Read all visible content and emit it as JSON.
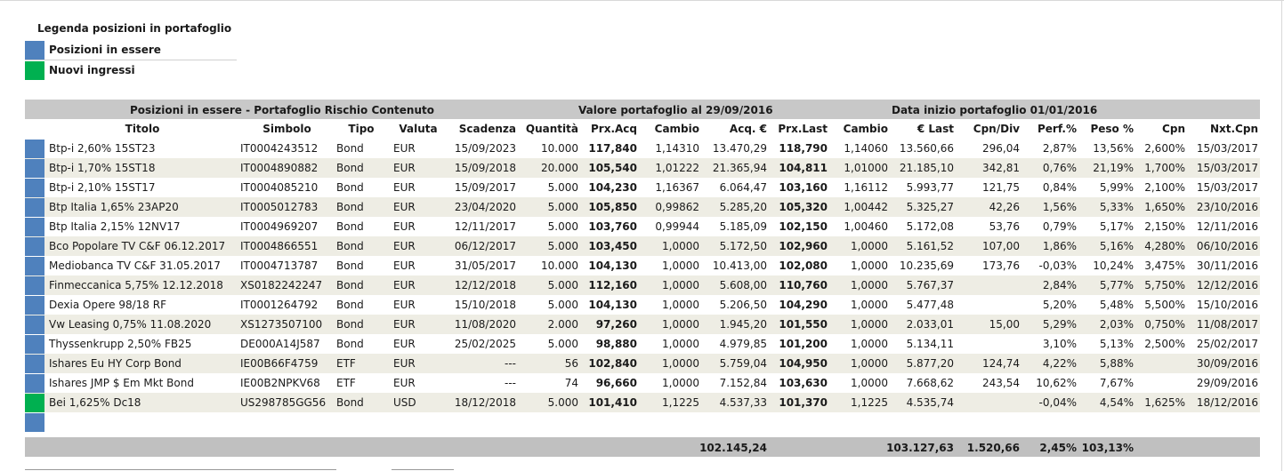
{
  "colors": {
    "existing": "#4f81bd",
    "new": "#00b050",
    "header_band": "#c8c8c8",
    "alt_row": "#eeede4",
    "total_band": "#c0c0c0"
  },
  "legend": {
    "title": "Legenda posizioni in portafoglio",
    "items": [
      {
        "label": "Posizioni in essere",
        "color": "#4f81bd"
      },
      {
        "label": "Nuovi ingressi",
        "color": "#00b050"
      }
    ]
  },
  "header": {
    "section": "Posizioni in essere - Portafoglio Rischio Contenuto",
    "value_date": "Valore portafoglio al 29/09/2016",
    "start_date": "Data inizio portafoglio 01/01/2016"
  },
  "columns": [
    "Titolo",
    "Simbolo",
    "Tipo",
    "Valuta",
    "Scadenza",
    "Quantità",
    "Prx.Acq",
    "Cambio",
    "Acq. €",
    "Prx.Last",
    "Cambio",
    "€ Last",
    "Cpn/Div",
    "Perf.%",
    "Peso %",
    "Cpn",
    "Nxt.Cpn"
  ],
  "rows": [
    {
      "status": "existing",
      "titolo": "Btp-i 2,60% 15ST23",
      "simbolo": "IT0004243512",
      "tipo": "Bond",
      "valuta": "EUR",
      "scadenza": "15/09/2023",
      "quantita": "10.000",
      "prx_acq": "117,840",
      "cambio_acq": "1,14310",
      "acq_eur": "13.470,29",
      "prx_last": "118,790",
      "cambio_last": "1,14060",
      "eur_last": "13.560,66",
      "cpn_div": "296,04",
      "perf": "2,87%",
      "peso": "13,56%",
      "cpn": "2,600%",
      "nxt_cpn": "15/03/2017"
    },
    {
      "status": "existing",
      "titolo": "Btp-i 1,70% 15ST18",
      "simbolo": "IT0004890882",
      "tipo": "Bond",
      "valuta": "EUR",
      "scadenza": "15/09/2018",
      "quantita": "20.000",
      "prx_acq": "105,540",
      "cambio_acq": "1,01222",
      "acq_eur": "21.365,94",
      "prx_last": "104,811",
      "cambio_last": "1,01000",
      "eur_last": "21.185,10",
      "cpn_div": "342,81",
      "perf": "0,76%",
      "peso": "21,19%",
      "cpn": "1,700%",
      "nxt_cpn": "15/03/2017"
    },
    {
      "status": "existing",
      "titolo": "Btp-i 2,10% 15ST17",
      "simbolo": "IT0004085210",
      "tipo": "Bond",
      "valuta": "EUR",
      "scadenza": "15/09/2017",
      "quantita": "5.000",
      "prx_acq": "104,230",
      "cambio_acq": "1,16367",
      "acq_eur": "6.064,47",
      "prx_last": "103,160",
      "cambio_last": "1,16112",
      "eur_last": "5.993,77",
      "cpn_div": "121,75",
      "perf": "0,84%",
      "peso": "5,99%",
      "cpn": "2,100%",
      "nxt_cpn": "15/03/2017"
    },
    {
      "status": "existing",
      "titolo": "Btp Italia 1,65% 23AP20",
      "simbolo": "IT0005012783",
      "tipo": "Bond",
      "valuta": "EUR",
      "scadenza": "23/04/2020",
      "quantita": "5.000",
      "prx_acq": "105,850",
      "cambio_acq": "0,99862",
      "acq_eur": "5.285,20",
      "prx_last": "105,320",
      "cambio_last": "1,00442",
      "eur_last": "5.325,27",
      "cpn_div": "42,26",
      "perf": "1,56%",
      "peso": "5,33%",
      "cpn": "1,650%",
      "nxt_cpn": "23/10/2016"
    },
    {
      "status": "existing",
      "titolo": "Btp Italia 2,15% 12NV17",
      "simbolo": "IT0004969207",
      "tipo": "Bond",
      "valuta": "EUR",
      "scadenza": "12/11/2017",
      "quantita": "5.000",
      "prx_acq": "103,760",
      "cambio_acq": "0,99944",
      "acq_eur": "5.185,09",
      "prx_last": "102,150",
      "cambio_last": "1,00460",
      "eur_last": "5.172,08",
      "cpn_div": "53,76",
      "perf": "0,79%",
      "peso": "5,17%",
      "cpn": "2,150%",
      "nxt_cpn": "12/11/2016"
    },
    {
      "status": "existing",
      "titolo": "Bco Popolare TV C&F 06.12.2017",
      "simbolo": "IT0004866551",
      "tipo": "Bond",
      "valuta": "EUR",
      "scadenza": "06/12/2017",
      "quantita": "5.000",
      "prx_acq": "103,450",
      "cambio_acq": "1,0000",
      "acq_eur": "5.172,50",
      "prx_last": "102,960",
      "cambio_last": "1,0000",
      "eur_last": "5.161,52",
      "cpn_div": "107,00",
      "perf": "1,86%",
      "peso": "5,16%",
      "cpn": "4,280%",
      "nxt_cpn": "06/10/2016"
    },
    {
      "status": "existing",
      "titolo": "Mediobanca TV C&F 31.05.2017",
      "simbolo": "IT0004713787",
      "tipo": "Bond",
      "valuta": "EUR",
      "scadenza": "31/05/2017",
      "quantita": "10.000",
      "prx_acq": "104,130",
      "cambio_acq": "1,0000",
      "acq_eur": "10.413,00",
      "prx_last": "102,080",
      "cambio_last": "1,0000",
      "eur_last": "10.235,69",
      "cpn_div": "173,76",
      "perf": "-0,03%",
      "peso": "10,24%",
      "cpn": "3,475%",
      "nxt_cpn": "30/11/2016"
    },
    {
      "status": "existing",
      "titolo": "Finmeccanica 5,75% 12.12.2018",
      "simbolo": "XS0182242247",
      "tipo": "Bond",
      "valuta": "EUR",
      "scadenza": "12/12/2018",
      "quantita": "5.000",
      "prx_acq": "112,160",
      "cambio_acq": "1,0000",
      "acq_eur": "5.608,00",
      "prx_last": "110,760",
      "cambio_last": "1,0000",
      "eur_last": "5.767,37",
      "cpn_div": "",
      "perf": "2,84%",
      "peso": "5,77%",
      "cpn": "5,750%",
      "nxt_cpn": "12/12/2016"
    },
    {
      "status": "existing",
      "titolo": "Dexia Opere 98/18 RF",
      "simbolo": "IT0001264792",
      "tipo": "Bond",
      "valuta": "EUR",
      "scadenza": "15/10/2018",
      "quantita": "5.000",
      "prx_acq": "104,130",
      "cambio_acq": "1,0000",
      "acq_eur": "5.206,50",
      "prx_last": "104,290",
      "cambio_last": "1,0000",
      "eur_last": "5.477,48",
      "cpn_div": "",
      "perf": "5,20%",
      "peso": "5,48%",
      "cpn": "5,500%",
      "nxt_cpn": "15/10/2016"
    },
    {
      "status": "existing",
      "titolo": "Vw Leasing 0,75% 11.08.2020",
      "simbolo": "XS1273507100",
      "tipo": "Bond",
      "valuta": "EUR",
      "scadenza": "11/08/2020",
      "quantita": "2.000",
      "prx_acq": "97,260",
      "cambio_acq": "1,0000",
      "acq_eur": "1.945,20",
      "prx_last": "101,550",
      "cambio_last": "1,0000",
      "eur_last": "2.033,01",
      "cpn_div": "15,00",
      "perf": "5,29%",
      "peso": "2,03%",
      "cpn": "0,750%",
      "nxt_cpn": "11/08/2017"
    },
    {
      "status": "existing",
      "titolo": "Thyssenkrupp 2,50% FB25",
      "simbolo": "DE000A14J587",
      "tipo": "Bond",
      "valuta": "EUR",
      "scadenza": "25/02/2025",
      "quantita": "5.000",
      "prx_acq": "98,880",
      "cambio_acq": "1,0000",
      "acq_eur": "4.979,85",
      "prx_last": "101,200",
      "cambio_last": "1,0000",
      "eur_last": "5.134,11",
      "cpn_div": "",
      "perf": "3,10%",
      "peso": "5,13%",
      "cpn": "2,500%",
      "nxt_cpn": "25/02/2017"
    },
    {
      "status": "existing",
      "titolo": "Ishares Eu HY Corp Bond",
      "simbolo": "IE00B66F4759",
      "tipo": "ETF",
      "valuta": "EUR",
      "scadenza": "---",
      "quantita": "56",
      "prx_acq": "102,840",
      "cambio_acq": "1,0000",
      "acq_eur": "5.759,04",
      "prx_last": "104,950",
      "cambio_last": "1,0000",
      "eur_last": "5.877,20",
      "cpn_div": "124,74",
      "perf": "4,22%",
      "peso": "5,88%",
      "cpn": "",
      "nxt_cpn": "30/09/2016"
    },
    {
      "status": "existing",
      "titolo": "Ishares JMP $ Em Mkt Bond",
      "simbolo": "IE00B2NPKV68",
      "tipo": "ETF",
      "valuta": "EUR",
      "scadenza": "---",
      "quantita": "74",
      "prx_acq": "96,660",
      "cambio_acq": "1,0000",
      "acq_eur": "7.152,84",
      "prx_last": "103,630",
      "cambio_last": "1,0000",
      "eur_last": "7.668,62",
      "cpn_div": "243,54",
      "perf": "10,62%",
      "peso": "7,67%",
      "cpn": "",
      "nxt_cpn": "29/09/2016"
    },
    {
      "status": "new",
      "titolo": "Bei 1,625% Dc18",
      "simbolo": "US298785GG56",
      "tipo": "Bond",
      "valuta": "USD",
      "scadenza": "18/12/2018",
      "quantita": "5.000",
      "prx_acq": "101,410",
      "cambio_acq": "1,1225",
      "acq_eur": "4.537,33",
      "prx_last": "101,370",
      "cambio_last": "1,1225",
      "eur_last": "4.535,74",
      "cpn_div": "",
      "perf": "-0,04%",
      "peso": "4,54%",
      "cpn": "1,625%",
      "nxt_cpn": "18/12/2016"
    }
  ],
  "totals": {
    "acq_eur": "102.145,24",
    "eur_last": "103.127,63",
    "cpn_div": "1.520,66",
    "perf": "2,45%",
    "peso": "103,13%"
  }
}
